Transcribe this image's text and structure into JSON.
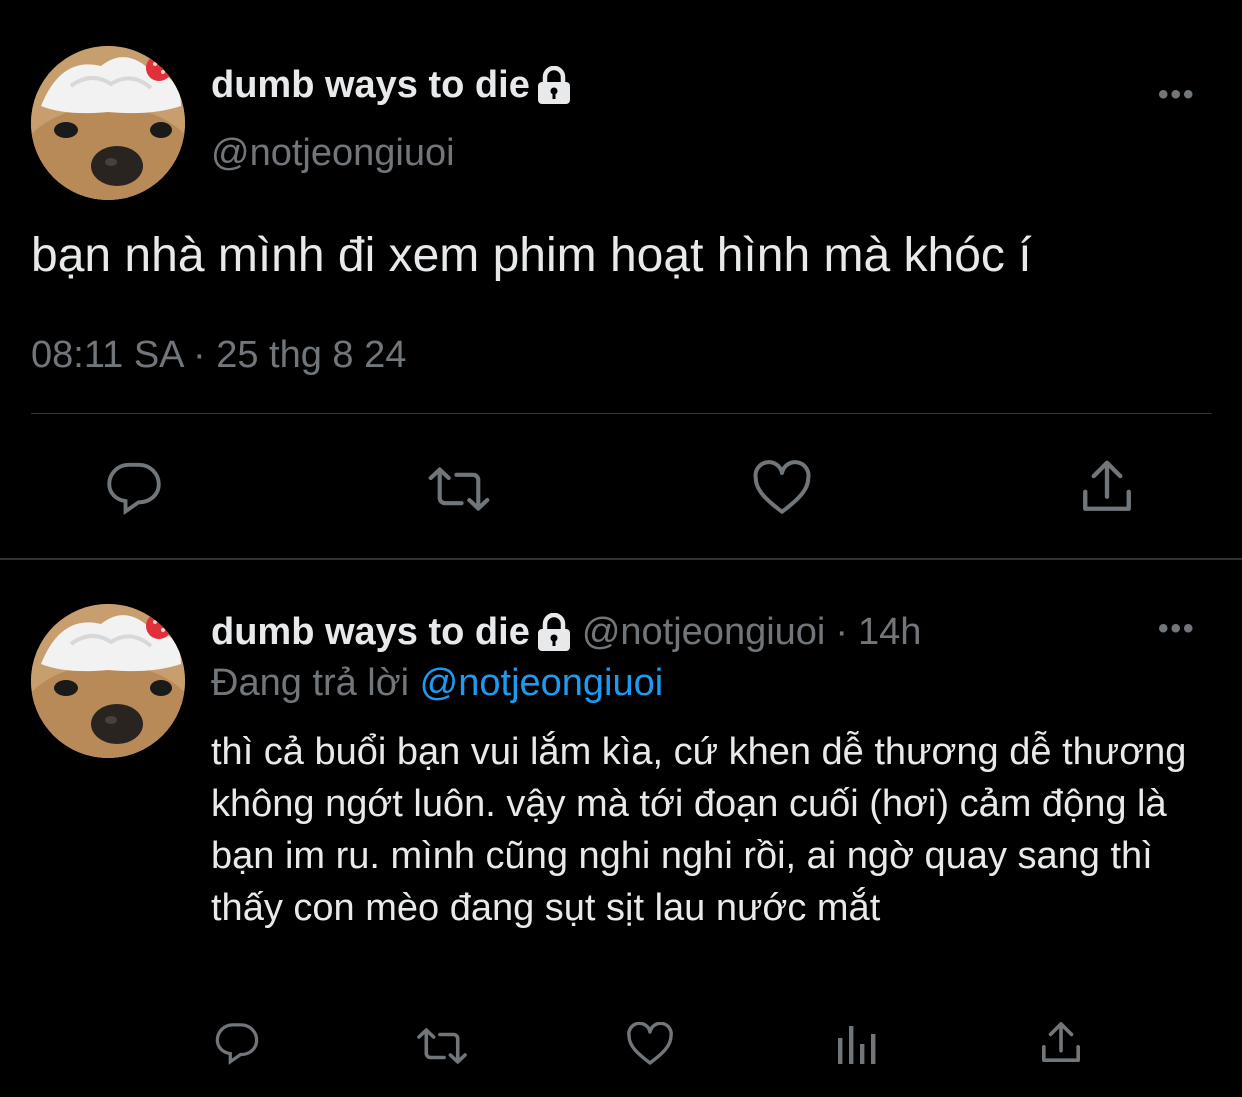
{
  "tweet": {
    "author": {
      "display_name": "dumb ways to die",
      "handle": "@notjeongiuoi"
    },
    "text": "bạn nhà mình đi xem phim hoạt hình mà khóc í",
    "timestamp": "08:11 SA · 25 thg 8 24",
    "more_label": "•••",
    "actions": {
      "reply_icon": "reply-icon",
      "retweet_icon": "retweet-icon",
      "like_icon": "heart-icon",
      "share_icon": "share-icon"
    }
  },
  "reply": {
    "author": {
      "display_name": "dumb ways to die",
      "handle": "@notjeongiuoi",
      "separator": "·",
      "time": "14h"
    },
    "replying_to_label": "Đang trả lời",
    "replying_to_handle": "@notjeongiuoi",
    "text": "thì cả buổi bạn vui lắm kìa, cứ khen dễ thương dễ thương không ngớt luôn. vậy mà tới đoạn cuối (hơi) cảm động là bạn im ru. mình cũng nghi nghi rồi, ai ngờ quay sang thì thấy con mèo đang sụt sịt lau nước mắt",
    "more_label": "•••",
    "actions": {
      "reply_icon": "reply-icon",
      "retweet_icon": "retweet-icon",
      "like_icon": "heart-icon",
      "views_icon": "analytics-icon",
      "share_icon": "share-icon"
    }
  },
  "colors": {
    "background": "#000000",
    "text_primary": "#e7e9ea",
    "text_secondary": "#71767b",
    "accent": "#1d9bf0",
    "divider": "#2f3336"
  }
}
